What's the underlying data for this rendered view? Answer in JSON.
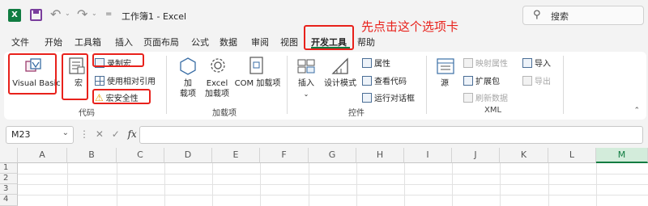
{
  "titlebar": {
    "app_icon": "X",
    "title": "工作簿1  -  Excel",
    "search_placeholder": "搜索",
    "customize_label": "="
  },
  "menu": {
    "tabs": [
      "文件",
      "开始",
      "工具箱",
      "插入",
      "页面布局",
      "公式",
      "数据",
      "审阅",
      "视图",
      "开发工具",
      "帮助"
    ],
    "active_tab": "开发工具"
  },
  "annotation": "先点击这个选项卡",
  "ribbon": {
    "code_group": {
      "label": "代码",
      "visual_basic": "Visual Basic",
      "macro": "宏",
      "record_macro": "录制宏",
      "relative_ref": "使用相对引用",
      "macro_security": "宏安全性"
    },
    "addins_group": {
      "label": "加载项",
      "addins_line1": "加",
      "addins_line2": "载项",
      "excel_addins_line1": "Excel",
      "excel_addins_line2": "加载项",
      "com_addins": "COM 加载项"
    },
    "controls_group": {
      "label": "控件",
      "insert": "插入",
      "design_mode": "设计模式",
      "properties": "属性",
      "view_code": "查看代码",
      "run_dialog": "运行对话框"
    },
    "xml_group": {
      "label": "XML",
      "source": "源",
      "map_properties": "映射属性",
      "expansion_packs": "扩展包",
      "refresh_data": "刷新数据",
      "import": "导入",
      "export": "导出"
    }
  },
  "formula_bar": {
    "name_box": "M23",
    "fx": "fx",
    "formula": ""
  },
  "grid": {
    "columns": [
      "A",
      "B",
      "C",
      "D",
      "E",
      "F",
      "G",
      "H",
      "I",
      "J",
      "K",
      "L",
      "M"
    ],
    "selected_column": "M",
    "rows": [
      "1",
      "2",
      "3",
      "4"
    ]
  },
  "colors": {
    "accent": "#107c41",
    "annotation": "#e8211b"
  }
}
